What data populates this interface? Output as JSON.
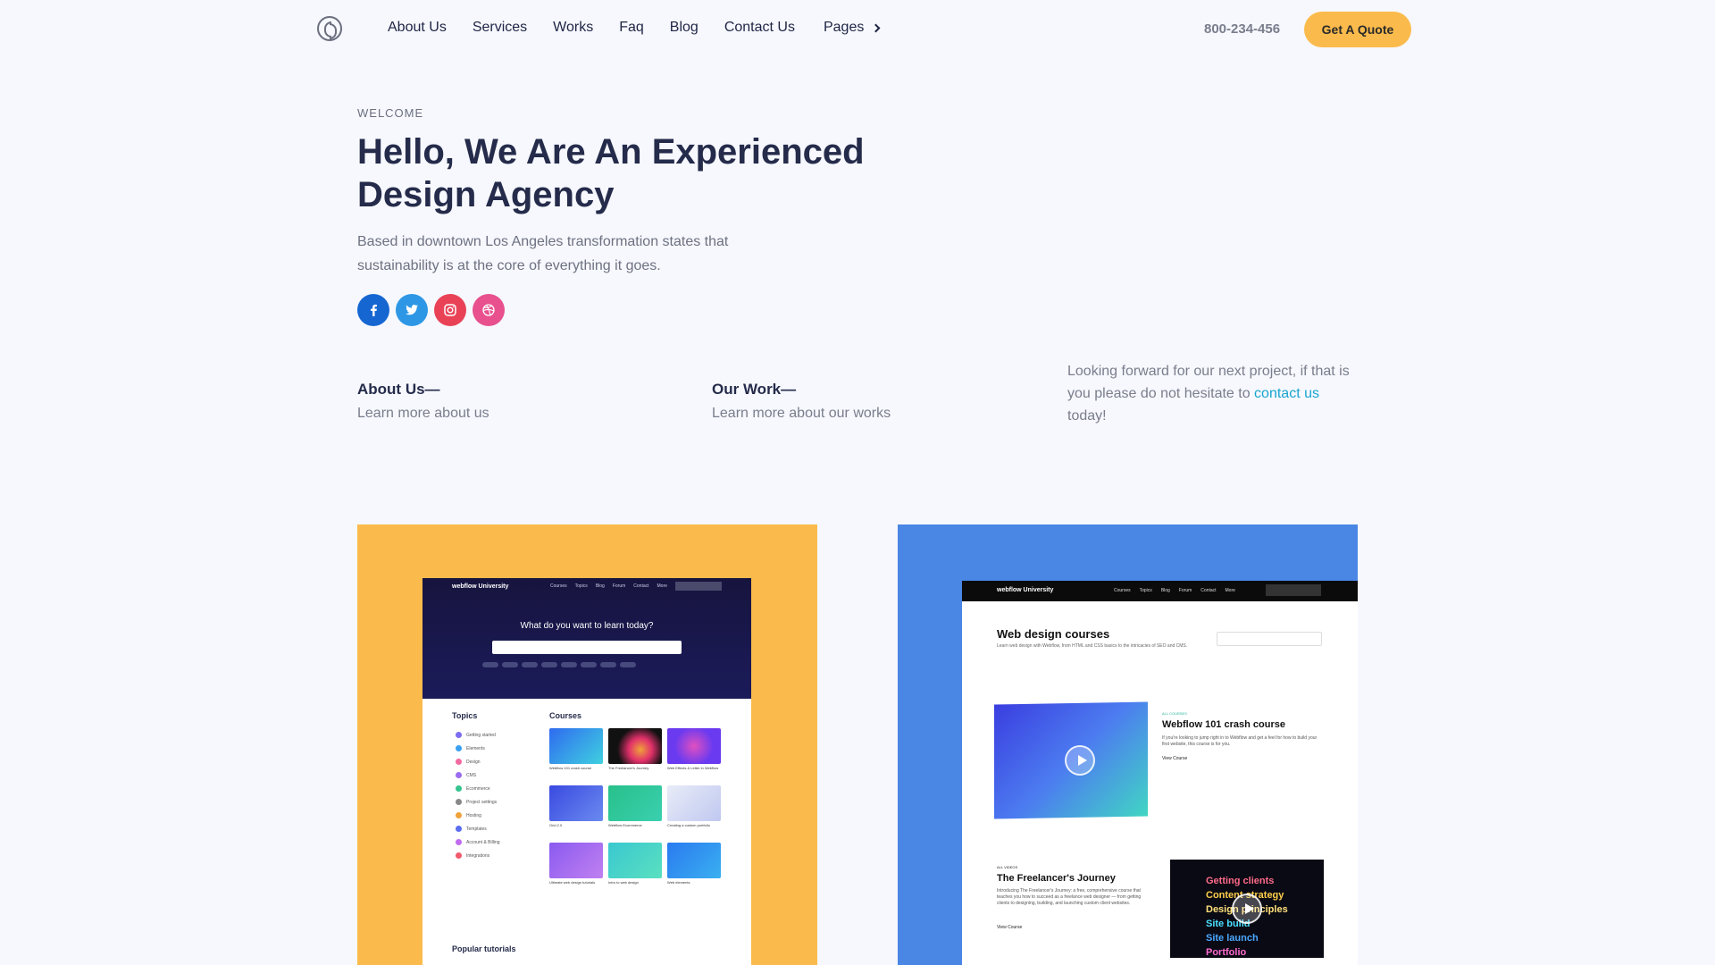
{
  "nav": {
    "links": [
      "About Us",
      "Services",
      "Works",
      "Faq",
      "Blog",
      "Contact Us"
    ],
    "pages_label": "Pages",
    "phone": "800-234-456",
    "quote_label": "Get A Quote"
  },
  "hero": {
    "eyebrow": "WELCOME",
    "headline": "Hello, We Are An Experienced Design Agency",
    "lead": "Based in downtown Los Angeles transformation states that sustainability is at the core of everything it goes.",
    "socials": [
      "facebook-icon",
      "twitter-icon",
      "instagram-icon",
      "dribbble-icon"
    ]
  },
  "info": {
    "about_title": "About Us—",
    "about_sub": "Learn more about us",
    "work_title": "Our Work—",
    "work_sub": "Learn more about our works",
    "contact_before": "Looking forward for our next project, if that is you please do not hesitate to",
    "contact_link": "contact us",
    "contact_after": "today!"
  },
  "colors": {
    "accent_yellow": "#fbbb4c",
    "accent_blue": "#4a86e4",
    "link": "#1aa4d0",
    "heading": "#252b4a"
  },
  "card_yellow": {
    "brand": "webflow University",
    "nav": [
      "Courses",
      "Topics",
      "Blog",
      "Forum",
      "Contact",
      "More"
    ],
    "question": "What do you want to learn today?",
    "topics_label": "Topics",
    "courses_label": "Courses",
    "topics": [
      "Getting started",
      "Elements",
      "Design",
      "CMS",
      "Ecommerce",
      "Project settings",
      "Hosting",
      "Templates",
      "Account & Billing",
      "Integrations"
    ],
    "course_captions": [
      "Webflow 101 crash course",
      "The Freelancer's Journey",
      "Web Effects & Letter in Webflow",
      "Grid 2.0",
      "Webflow Ecommerce",
      "Creating a custom portfolio",
      "Ultimate web design tutorials",
      "Intro to web design",
      "Web elements"
    ],
    "popular_label": "Popular tutorials"
  },
  "card_blue": {
    "brand": "webflow University",
    "nav": [
      "Courses",
      "Topics",
      "Blog",
      "Forum",
      "Contact",
      "More"
    ],
    "title": "Web design courses",
    "desc": "Learn web design with Webflow, from HTML and CSS basics to the intricacies of SEO and CMS.",
    "course1_tag": "ALL COURSES",
    "course1_title": "Webflow 101 crash course",
    "course1_desc": "If you're looking to jump right in to Webflow and get a feel for how to build your first website, this course is for you.",
    "course1_link": "View Course",
    "course2_tag": "ALL VIDEOS",
    "course2_title": "The Freelancer's Journey",
    "course2_desc": "Introducing The Freelancer's Journey: a free, comprehensive course that teaches you how to succeed as a freelance web designer — from getting clients to designing, building, and launching custom client websites.",
    "course2_link": "View Course",
    "video2_words": [
      "Getting clients",
      "Content strategy",
      "Design principles",
      "Site build",
      "Site launch",
      "Portfolio"
    ]
  }
}
